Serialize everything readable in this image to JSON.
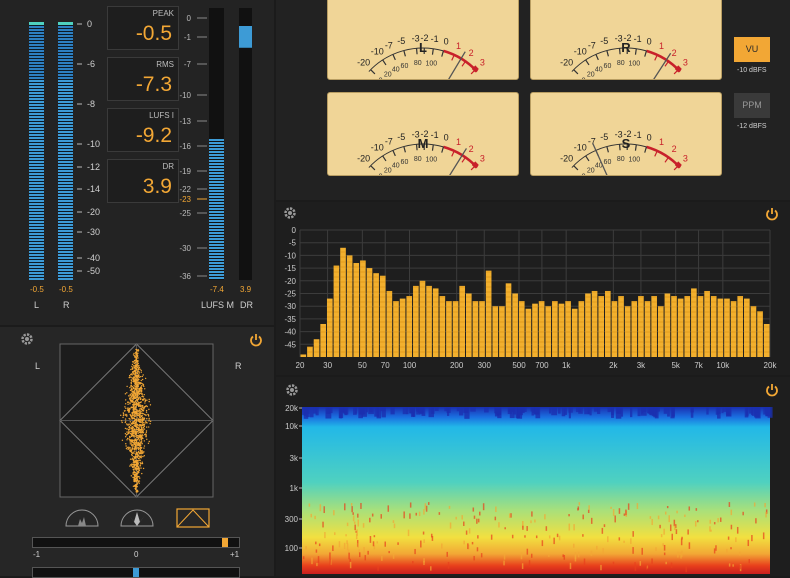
{
  "level_meters": {
    "scale": [
      "0",
      "-6",
      "-8",
      "-10",
      "-12",
      "-14",
      "-20",
      "-30",
      "-40",
      "-50"
    ],
    "channels": [
      {
        "label": "L",
        "peak": "-0.5"
      },
      {
        "label": "R",
        "peak": "-0.5"
      }
    ]
  },
  "stats": [
    {
      "name": "PEAK",
      "value": "-0.5"
    },
    {
      "name": "RMS",
      "value": "-7.3"
    },
    {
      "name": "LUFS I",
      "value": "-9.2"
    },
    {
      "name": "DR",
      "value": "3.9"
    }
  ],
  "lufs_meter": {
    "scale": [
      "0",
      "-1",
      "-7",
      "-10",
      "-13",
      "-16",
      "-19",
      "-22",
      "-23",
      "-25",
      "-30",
      "-36"
    ],
    "highlight_tick": "-23",
    "lufs_label": "LUFS M",
    "lufs_value": "-7.4",
    "lufs_level": 0.52,
    "dr_label": "DR",
    "dr_value": "3.9",
    "dr_level": 0.08
  },
  "vu_meters": {
    "scale_top": [
      "-5",
      "-3",
      "-2",
      "-1",
      "0",
      "+1",
      "+2",
      "+3"
    ],
    "scale_labels": [
      "-20",
      "-10",
      "-7",
      "-5",
      "-3",
      "-2",
      "-1",
      "0",
      "1",
      "2",
      "3"
    ],
    "pct_labels": [
      "0",
      "20",
      "40",
      "60",
      "80",
      "100"
    ],
    "channels": [
      {
        "name": "L",
        "needle_db": 1.6
      },
      {
        "name": "R",
        "needle_db": 1.8
      },
      {
        "name": "M",
        "needle_db": 1.7
      },
      {
        "name": "S",
        "needle_db": -7
      }
    ]
  },
  "modes": {
    "vu_label": "VU",
    "vu_ref": "-10 dBFS",
    "ppm_label": "PPM",
    "ppm_ref": "-12 dBFS"
  },
  "goniometer": {
    "left_label": "L",
    "right_label": "R",
    "correlation_scale": [
      "-1",
      "0",
      "+1"
    ],
    "correlation_value": 0.92,
    "balance_value": 0.0
  },
  "colors": {
    "accent": "#f2a735",
    "vu_face": "#f0d597",
    "meter_blue": "#3d9bd6"
  },
  "chart_data": {
    "type": "bar",
    "ylabel_ticks": [
      "0",
      "-5",
      "-10",
      "-15",
      "-20",
      "-25",
      "-30",
      "-35",
      "-40",
      "-45"
    ],
    "xlabel_ticks": [
      "20",
      "30",
      "50",
      "70",
      "100",
      "200",
      "300",
      "500",
      "700",
      "1k",
      "2k",
      "3k",
      "5k",
      "7k",
      "10k",
      "20k"
    ],
    "ylim": [
      -50,
      0
    ],
    "xscale": "log",
    "grid": true,
    "values": [
      -49,
      -46,
      -43,
      -37,
      -27,
      -14,
      -7,
      -10,
      -13,
      -12,
      -15,
      -17,
      -18,
      -24,
      -28,
      -27,
      -26,
      -22,
      -20,
      -22,
      -23,
      -26,
      -28,
      -28,
      -22,
      -25,
      -28,
      -28,
      -16,
      -30,
      -30,
      -21,
      -25,
      -28,
      -31,
      -29,
      -28,
      -30,
      -28,
      -29,
      -28,
      -31,
      -28,
      -25,
      -24,
      -26,
      -24,
      -28,
      -26,
      -30,
      -28,
      -26,
      -28,
      -26,
      -30,
      -25,
      -26,
      -27,
      -26,
      -23,
      -26,
      -24,
      -26,
      -27,
      -27,
      -28,
      -26,
      -27,
      -30,
      -32,
      -37
    ],
    "spectrogram": {
      "y_ticks": [
        "20k",
        "10k",
        "3k",
        "1k",
        "300",
        "100"
      ]
    }
  }
}
